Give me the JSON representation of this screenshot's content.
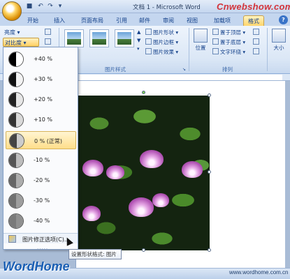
{
  "window": {
    "title": "文档 1 - Microsoft Word",
    "watermark_site": "Cnwebshow.com"
  },
  "quick_access": [
    "save-icon",
    "undo-icon",
    "redo-icon",
    "customize-icon"
  ],
  "tabs": [
    {
      "label": "开始",
      "active": false
    },
    {
      "label": "插入",
      "active": false
    },
    {
      "label": "页面布局",
      "active": false
    },
    {
      "label": "引用",
      "active": false
    },
    {
      "label": "邮件",
      "active": false
    },
    {
      "label": "审阅",
      "active": false
    },
    {
      "label": "视图",
      "active": false
    },
    {
      "label": "加载项",
      "active": false
    },
    {
      "label": "格式",
      "active": true
    }
  ],
  "help_label": "?",
  "ribbon": {
    "brightness_label": "亮度 ▾",
    "contrast_label": "对比度 ▾",
    "picture_styles_label": "图片样式",
    "picture_shape": "图片形状 ▾",
    "picture_border": "图片边框 ▾",
    "picture_effects": "图片效果 ▾",
    "position_label": "位置",
    "bring_front": "置于顶层 ▾",
    "send_back": "置于底层 ▾",
    "text_wrap": "文字环绕 ▾",
    "arrange_label": "排列",
    "size_label": "大小"
  },
  "contrast_menu": {
    "items": [
      {
        "label": "+40 %",
        "selected": false,
        "shade_left": "#000000",
        "shade_right": "#ffffff"
      },
      {
        "label": "+30 %",
        "selected": false,
        "shade_left": "#111111",
        "shade_right": "#f2f2f2"
      },
      {
        "label": "+20 %",
        "selected": false,
        "shade_left": "#222222",
        "shade_right": "#e6e6e6"
      },
      {
        "label": "+10 %",
        "selected": false,
        "shade_left": "#333333",
        "shade_right": "#d9d9d9"
      },
      {
        "label": "0 % (正常)",
        "selected": true,
        "shade_left": "#444444",
        "shade_right": "#cccccc"
      },
      {
        "label": "-10 %",
        "selected": false,
        "shade_left": "#555555",
        "shade_right": "#bdbdbd"
      },
      {
        "label": "-20 %",
        "selected": false,
        "shade_left": "#666666",
        "shade_right": "#adadad"
      },
      {
        "label": "-30 %",
        "selected": false,
        "shade_left": "#707070",
        "shade_right": "#9e9e9e"
      },
      {
        "label": "-40 %",
        "selected": false,
        "shade_left": "#7a7a7a",
        "shade_right": "#909090"
      }
    ],
    "footer_label": "图片修正选项(C)...",
    "grip": "....."
  },
  "tooltip": "设置形状格式: 图片",
  "footer_watermark": "WordHome",
  "footer_url": "www.wordhome.com.cn"
}
